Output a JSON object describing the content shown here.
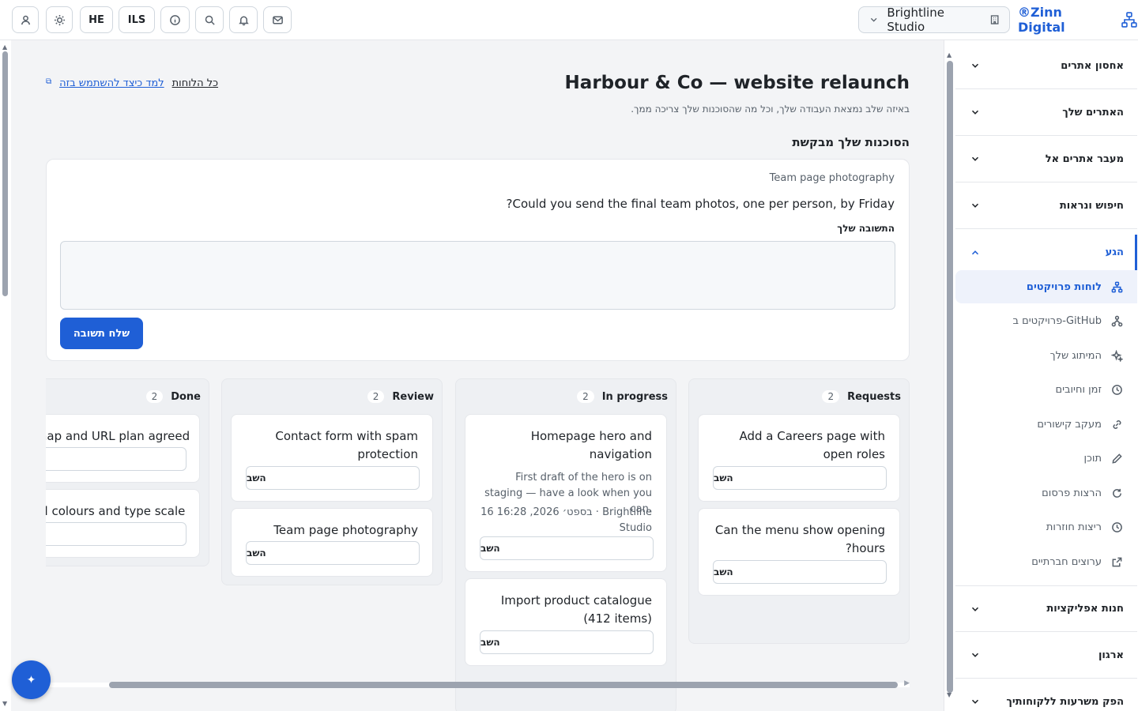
{
  "topbar": {
    "lang": "HE",
    "currency": "ILS",
    "workspace": "Brightline Studio",
    "brand": "®Zinn Digital"
  },
  "page": {
    "title": "Harbour & Co — website relaunch",
    "subtitle": "באיזה שלב נמצאת העבודה שלך, וכל מה שהסוכנות שלך צריכה ממך.",
    "link_all_boards": "כל הלוחות",
    "link_learn": "למד כיצד להשתמש בזה",
    "request_heading": "הסוכנות שלך מבקשת"
  },
  "reply": {
    "context": "Team page photography",
    "question": "?Could you send the final team photos, one per person, by Friday",
    "label": "התשובה שלך",
    "textarea_value": "",
    "send_label": "שלח תשובה"
  },
  "board": {
    "reply_label": "השב",
    "columns": [
      {
        "name": "Requests",
        "count": "2",
        "cards": [
          {
            "title": "Add a Careers page with open roles"
          },
          {
            "title": "Can the menu show opening ?hours"
          }
        ]
      },
      {
        "name": "In progress",
        "count": "2",
        "cards": [
          {
            "title": "Homepage hero and navigation",
            "description": "First draft of the hero is on staging — have a look when you can.",
            "meta": "16 בספט׳ 2026, 16:28 · Brightline Studio"
          },
          {
            "title": "Import product catalogue (412 items)"
          }
        ]
      },
      {
        "name": "Review",
        "count": "2",
        "cards": [
          {
            "title": "Contact form with spam protection"
          },
          {
            "title": "Team page photography"
          }
        ]
      },
      {
        "name": "Done",
        "count": "2",
        "cards": [
          {
            "title": "Sitemap and URL plan agreed"
          },
          {
            "title": "Brand colours and type scale"
          }
        ]
      }
    ]
  },
  "sidebar": {
    "sections": [
      {
        "label": "אחסון אתרים"
      },
      {
        "label": "האתרים שלך"
      },
      {
        "label": "מעבר אתרים אל"
      },
      {
        "label": "חיפוש ונראות"
      },
      {
        "label": "הגע"
      }
    ],
    "items": [
      {
        "label": "לוחות פרויקטים",
        "icon": "project-board-icon"
      },
      {
        "label": "פרויקטים ב-GitHub",
        "icon": "github-projects-icon"
      },
      {
        "label": "המיתוג שלך",
        "icon": "sparkle-icon"
      },
      {
        "label": "זמן וחיובים",
        "icon": "clock-icon"
      },
      {
        "label": "מעקב קישורים",
        "icon": "link-icon"
      },
      {
        "label": "תוכן",
        "icon": "pencil-icon"
      },
      {
        "label": "הרצות פרסום",
        "icon": "refresh-icon"
      },
      {
        "label": "ריצות חוזרות",
        "icon": "clock-icon"
      },
      {
        "label": "ערוצים חברתיים",
        "icon": "external-link-icon"
      }
    ],
    "bottom_sections": [
      {
        "label": "חנות אפליקציות"
      },
      {
        "label": "ארגון"
      },
      {
        "label": "הפק משרעות ללקוחותיך"
      }
    ]
  }
}
